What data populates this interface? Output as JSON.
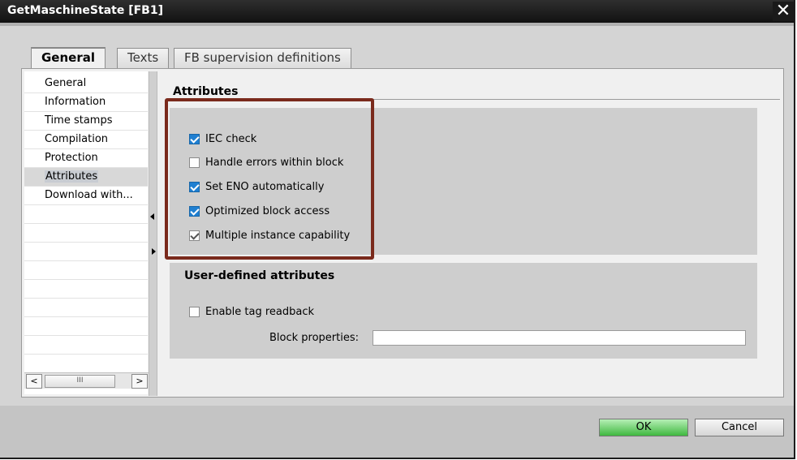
{
  "window": {
    "title": "GetMaschineState [FB1]",
    "close_glyph": "✕"
  },
  "tabs": [
    {
      "label": "General",
      "active": true
    },
    {
      "label": "Texts",
      "active": false
    },
    {
      "label": "FB supervision definitions",
      "active": false
    }
  ],
  "nav": {
    "items": [
      {
        "label": "General"
      },
      {
        "label": "Information"
      },
      {
        "label": "Time stamps"
      },
      {
        "label": "Compilation"
      },
      {
        "label": "Protection"
      },
      {
        "label": "Attributes",
        "selected": true
      },
      {
        "label": "Download with..."
      }
    ],
    "scroll_left": "<",
    "scroll_thumb": "III",
    "scroll_right": ">"
  },
  "attributes": {
    "title": "Attributes",
    "options": [
      {
        "label": "IEC check",
        "checked": true,
        "style": "blue"
      },
      {
        "label": "Handle errors within block",
        "checked": false,
        "style": "none"
      },
      {
        "label": "Set ENO automatically",
        "checked": true,
        "style": "blue"
      },
      {
        "label": "Optimized block access",
        "checked": true,
        "style": "blue"
      },
      {
        "label": "Multiple instance capability",
        "checked": true,
        "style": "gray"
      }
    ]
  },
  "user_defined": {
    "title": "User-defined attributes",
    "enable_tag_readback": {
      "label": "Enable tag readback",
      "checked": false
    },
    "block_properties": {
      "label": "Block properties:",
      "value": ""
    }
  },
  "buttons": {
    "ok": "OK",
    "cancel": "Cancel"
  },
  "colors": {
    "highlight_border": "#7a2a1c",
    "check_blue": "#1f7fd1",
    "ok_green": "#3fb83f"
  }
}
